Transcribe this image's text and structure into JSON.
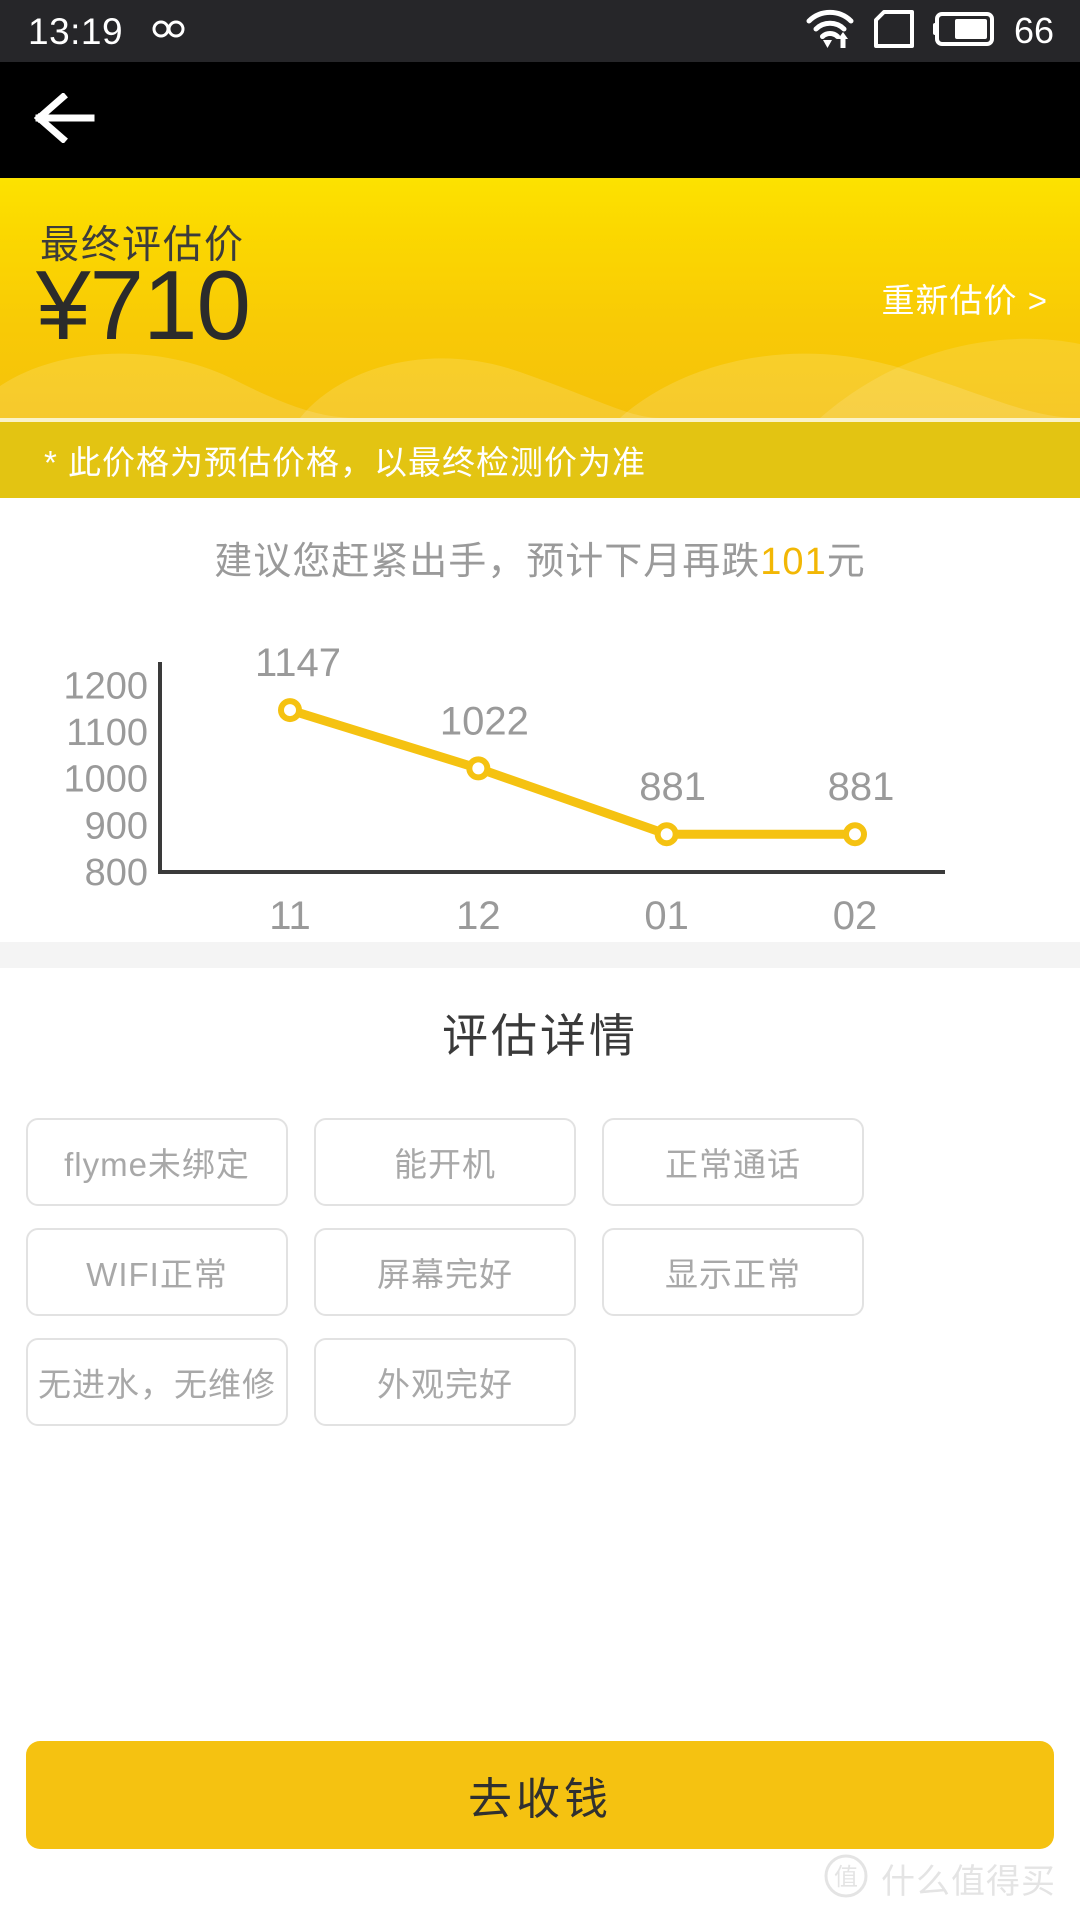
{
  "status_bar": {
    "time": "13:19",
    "infinity_icon": "infinity-icon",
    "wifi_icon": "wifi-icon",
    "sim_icon": "sim-card-icon",
    "battery_icon": "battery-icon",
    "battery_level": "66"
  },
  "nav": {
    "back_icon": "back-arrow-icon"
  },
  "hero": {
    "label": "最终评估价",
    "price": "¥710",
    "revaluate": "重新估价 >",
    "bg_color_top": "#FCE200",
    "bg_color_bottom": "#F5C10B"
  },
  "disclaimer": {
    "text": "* 此价格为预估价格，以最终检测价为准",
    "bg_color": "#E3C412"
  },
  "advice": {
    "prefix": "建议您赶紧出手，预计下月再跌",
    "amount": "101",
    "suffix": "元",
    "highlight_color": "#F2B705"
  },
  "chart_data": {
    "type": "line",
    "title": "",
    "xlabel": "",
    "ylabel": "",
    "categories": [
      "11",
      "12",
      "01",
      "02"
    ],
    "values": [
      1147,
      1022,
      881,
      881
    ],
    "point_labels": [
      "1147",
      "1022",
      "881",
      "881"
    ],
    "yticks": [
      "1200",
      "1100",
      "1000",
      "900",
      "800"
    ],
    "ytick_values": [
      1200,
      1100,
      1000,
      900,
      800
    ],
    "ylim": [
      800,
      1250
    ],
    "grid": false,
    "legend": "none",
    "line_color": "#F5C211",
    "marker_fill": "#ffffff",
    "axis_color": "#3a3a3a",
    "label_color": "#9a9a9a"
  },
  "details": {
    "title": "评估详情",
    "tags": [
      "flyme未绑定",
      "能开机",
      "正常通话",
      "WIFI正常",
      "屏幕完好",
      "显示正常",
      "无进水，无维修",
      "外观完好"
    ]
  },
  "cta": {
    "label": "去收钱",
    "color": "#F5C211"
  },
  "watermark": {
    "logo_char": "值",
    "text": "什么值得买"
  }
}
